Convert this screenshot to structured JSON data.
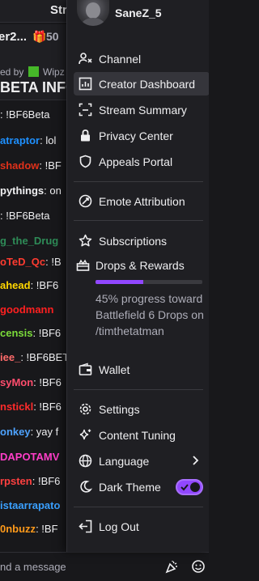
{
  "chat": {
    "header_text": "Str",
    "pinned": {
      "name": "er2...",
      "gift_count": "50"
    },
    "announcement": {
      "by_text": "ed by",
      "by_user": "Wipz",
      "title": "ETA INFO:",
      "line": ": !BF6Beta"
    },
    "messages": [
      {
        "user": "atraptor",
        "text": ": lol",
        "color": "#1e90ff"
      },
      {
        "user": "shadow",
        "text": ": !BF",
        "color": "#e0311a"
      },
      {
        "user": "pythings",
        "text": ": on",
        "color": "#efeff1"
      },
      {
        "user": "",
        "text": ": !BF6Beta",
        "color": "#efeff1"
      },
      {
        "user": "g_the_Drug",
        "text": "",
        "color": "#2e8b57"
      },
      {
        "user": "oTeD_Qc",
        "text": ": !B",
        "color": "#ff3b30"
      },
      {
        "user": "ahead",
        "text": ": !BF6",
        "color": "#ffd700"
      },
      {
        "user": "goodmann",
        "text": "",
        "color": "#ff2020"
      },
      {
        "user": "censis",
        "text": ": !BF6",
        "color": "#7bdc3a"
      },
      {
        "user": "iee_",
        "text": ": !BF6BET",
        "color": "#ff6b6b"
      },
      {
        "user": "syMon",
        "text": ": !BF6",
        "color": "#ff4d6d"
      },
      {
        "user": "nstickl",
        "text": ": !BF6",
        "color": "#ff2b2b"
      },
      {
        "user": "onkey",
        "text": ": yay f",
        "color": "#4ea3ff"
      },
      {
        "user": "DAPOTAMV",
        "text": "",
        "color": "#ff3ec8"
      },
      {
        "user": "rpsten",
        "text": ": !BF6",
        "color": "#ff4040"
      },
      {
        "user": "istaarrapato",
        "text": "",
        "color": "#3aa0ff"
      },
      {
        "user": "0nbuzz",
        "text": ": !BF",
        "color": "#ff9a1a"
      }
    ],
    "input_placeholder": "nd a message"
  },
  "menu": {
    "username": "SaneZ_5",
    "items": {
      "channel": "Channel",
      "creator_dashboard": "Creator Dashboard",
      "stream_summary": "Stream Summary",
      "privacy_center": "Privacy Center",
      "appeals_portal": "Appeals Portal",
      "emote_attribution": "Emote Attribution",
      "subscriptions": "Subscriptions",
      "drops_rewards": "Drops & Rewards",
      "wallet": "Wallet",
      "settings": "Settings",
      "content_tuning": "Content Tuning",
      "language": "Language",
      "dark_theme": "Dark Theme",
      "log_out": "Log Out"
    },
    "drops_progress": {
      "percent": 45,
      "text": "45% progress toward Battlefield 6 Drops on /timthetatman"
    },
    "dark_theme_on": true
  },
  "colors": {
    "accent": "#9147ff",
    "menu_bg": "#1f1f23",
    "highlight": "#35353b"
  }
}
